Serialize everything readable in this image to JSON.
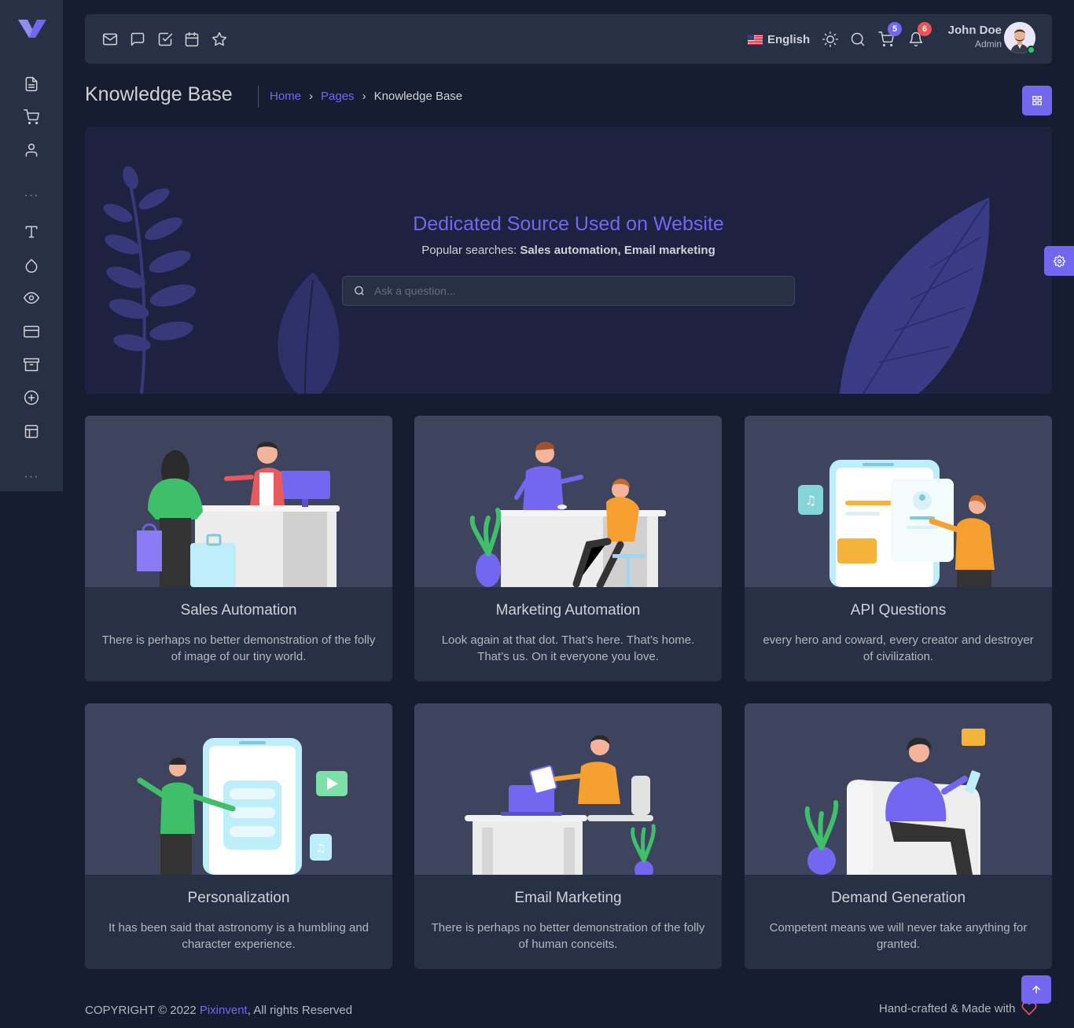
{
  "sidebar": {
    "items": [
      {
        "icon": "file-text-icon"
      },
      {
        "icon": "shopping-cart-icon"
      },
      {
        "icon": "user-icon"
      },
      {
        "icon": "type-icon"
      },
      {
        "icon": "droplet-icon"
      },
      {
        "icon": "eye-icon"
      },
      {
        "icon": "credit-card-icon"
      },
      {
        "icon": "archive-icon"
      },
      {
        "icon": "plus-circle-icon"
      },
      {
        "icon": "layout-icon"
      }
    ],
    "dots": "···"
  },
  "navbar": {
    "bookmarks": [
      "mail-icon",
      "message-square-icon",
      "check-square-icon",
      "calendar-icon",
      "star-icon"
    ],
    "language": "English",
    "cart_count": "5",
    "notification_count": "6",
    "user_name": "John Doe",
    "user_role": "Admin"
  },
  "breadcrumb": {
    "title": "Knowledge Base",
    "home": "Home",
    "pages": "Pages",
    "current": "Knowledge Base"
  },
  "hero": {
    "title": "Dedicated Source Used on Website",
    "popular_label": "Popular searches:",
    "popular_terms": "Sales automation, Email marketing",
    "search_placeholder": "Ask a question..."
  },
  "cards": [
    {
      "title": "Sales Automation",
      "text": "There is perhaps no better demonstration of the folly of image of our tiny world."
    },
    {
      "title": "Marketing Automation",
      "text": "Look again at that dot. That’s here. That’s home. That’s us. On it everyone you love."
    },
    {
      "title": "API Questions",
      "text": "every hero and coward, every creator and destroyer of civilization."
    },
    {
      "title": "Personalization",
      "text": "It has been said that astronomy is a humbling and character experience."
    },
    {
      "title": "Email Marketing",
      "text": "There is perhaps no better demonstration of the folly of human conceits."
    },
    {
      "title": "Demand Generation",
      "text": "Competent means we will never take anything for granted."
    }
  ],
  "footer": {
    "copyright": "COPYRIGHT © 2022",
    "brand": "Pixinvent",
    "rights": ", All rights Reserved",
    "made_with": "Hand-crafted & Made with"
  },
  "colors": {
    "primary": "#7367f0",
    "body_bg": "#161d31",
    "card_bg": "#283046",
    "danger": "#ea5455",
    "success": "#28c76f"
  }
}
